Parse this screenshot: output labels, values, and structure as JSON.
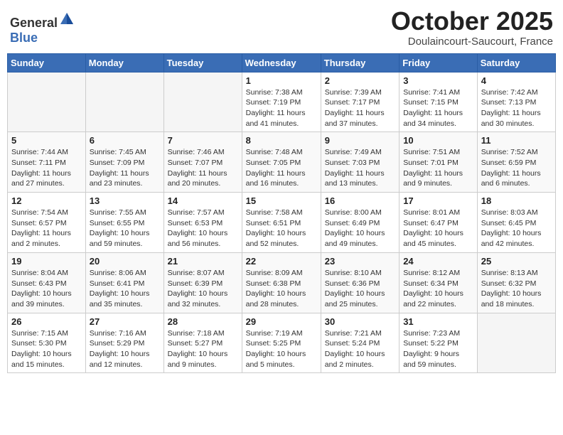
{
  "header": {
    "logo": {
      "general": "General",
      "blue": "Blue"
    },
    "month": "October 2025",
    "location": "Doulaincourt-Saucourt, France"
  },
  "weekdays": [
    "Sunday",
    "Monday",
    "Tuesday",
    "Wednesday",
    "Thursday",
    "Friday",
    "Saturday"
  ],
  "weeks": [
    [
      {
        "day": "",
        "info": ""
      },
      {
        "day": "",
        "info": ""
      },
      {
        "day": "",
        "info": ""
      },
      {
        "day": "1",
        "info": "Sunrise: 7:38 AM\nSunset: 7:19 PM\nDaylight: 11 hours\nand 41 minutes."
      },
      {
        "day": "2",
        "info": "Sunrise: 7:39 AM\nSunset: 7:17 PM\nDaylight: 11 hours\nand 37 minutes."
      },
      {
        "day": "3",
        "info": "Sunrise: 7:41 AM\nSunset: 7:15 PM\nDaylight: 11 hours\nand 34 minutes."
      },
      {
        "day": "4",
        "info": "Sunrise: 7:42 AM\nSunset: 7:13 PM\nDaylight: 11 hours\nand 30 minutes."
      }
    ],
    [
      {
        "day": "5",
        "info": "Sunrise: 7:44 AM\nSunset: 7:11 PM\nDaylight: 11 hours\nand 27 minutes."
      },
      {
        "day": "6",
        "info": "Sunrise: 7:45 AM\nSunset: 7:09 PM\nDaylight: 11 hours\nand 23 minutes."
      },
      {
        "day": "7",
        "info": "Sunrise: 7:46 AM\nSunset: 7:07 PM\nDaylight: 11 hours\nand 20 minutes."
      },
      {
        "day": "8",
        "info": "Sunrise: 7:48 AM\nSunset: 7:05 PM\nDaylight: 11 hours\nand 16 minutes."
      },
      {
        "day": "9",
        "info": "Sunrise: 7:49 AM\nSunset: 7:03 PM\nDaylight: 11 hours\nand 13 minutes."
      },
      {
        "day": "10",
        "info": "Sunrise: 7:51 AM\nSunset: 7:01 PM\nDaylight: 11 hours\nand 9 minutes."
      },
      {
        "day": "11",
        "info": "Sunrise: 7:52 AM\nSunset: 6:59 PM\nDaylight: 11 hours\nand 6 minutes."
      }
    ],
    [
      {
        "day": "12",
        "info": "Sunrise: 7:54 AM\nSunset: 6:57 PM\nDaylight: 11 hours\nand 2 minutes."
      },
      {
        "day": "13",
        "info": "Sunrise: 7:55 AM\nSunset: 6:55 PM\nDaylight: 10 hours\nand 59 minutes."
      },
      {
        "day": "14",
        "info": "Sunrise: 7:57 AM\nSunset: 6:53 PM\nDaylight: 10 hours\nand 56 minutes."
      },
      {
        "day": "15",
        "info": "Sunrise: 7:58 AM\nSunset: 6:51 PM\nDaylight: 10 hours\nand 52 minutes."
      },
      {
        "day": "16",
        "info": "Sunrise: 8:00 AM\nSunset: 6:49 PM\nDaylight: 10 hours\nand 49 minutes."
      },
      {
        "day": "17",
        "info": "Sunrise: 8:01 AM\nSunset: 6:47 PM\nDaylight: 10 hours\nand 45 minutes."
      },
      {
        "day": "18",
        "info": "Sunrise: 8:03 AM\nSunset: 6:45 PM\nDaylight: 10 hours\nand 42 minutes."
      }
    ],
    [
      {
        "day": "19",
        "info": "Sunrise: 8:04 AM\nSunset: 6:43 PM\nDaylight: 10 hours\nand 39 minutes."
      },
      {
        "day": "20",
        "info": "Sunrise: 8:06 AM\nSunset: 6:41 PM\nDaylight: 10 hours\nand 35 minutes."
      },
      {
        "day": "21",
        "info": "Sunrise: 8:07 AM\nSunset: 6:39 PM\nDaylight: 10 hours\nand 32 minutes."
      },
      {
        "day": "22",
        "info": "Sunrise: 8:09 AM\nSunset: 6:38 PM\nDaylight: 10 hours\nand 28 minutes."
      },
      {
        "day": "23",
        "info": "Sunrise: 8:10 AM\nSunset: 6:36 PM\nDaylight: 10 hours\nand 25 minutes."
      },
      {
        "day": "24",
        "info": "Sunrise: 8:12 AM\nSunset: 6:34 PM\nDaylight: 10 hours\nand 22 minutes."
      },
      {
        "day": "25",
        "info": "Sunrise: 8:13 AM\nSunset: 6:32 PM\nDaylight: 10 hours\nand 18 minutes."
      }
    ],
    [
      {
        "day": "26",
        "info": "Sunrise: 7:15 AM\nSunset: 5:30 PM\nDaylight: 10 hours\nand 15 minutes."
      },
      {
        "day": "27",
        "info": "Sunrise: 7:16 AM\nSunset: 5:29 PM\nDaylight: 10 hours\nand 12 minutes."
      },
      {
        "day": "28",
        "info": "Sunrise: 7:18 AM\nSunset: 5:27 PM\nDaylight: 10 hours\nand 9 minutes."
      },
      {
        "day": "29",
        "info": "Sunrise: 7:19 AM\nSunset: 5:25 PM\nDaylight: 10 hours\nand 5 minutes."
      },
      {
        "day": "30",
        "info": "Sunrise: 7:21 AM\nSunset: 5:24 PM\nDaylight: 10 hours\nand 2 minutes."
      },
      {
        "day": "31",
        "info": "Sunrise: 7:23 AM\nSunset: 5:22 PM\nDaylight: 9 hours\nand 59 minutes."
      },
      {
        "day": "",
        "info": ""
      }
    ]
  ]
}
